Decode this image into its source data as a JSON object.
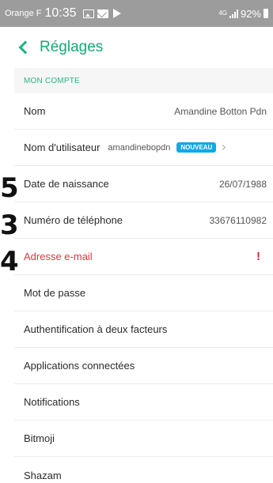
{
  "status_bar": {
    "carrier": "Orange F",
    "time": "10:35",
    "network": "4G",
    "battery": "92%"
  },
  "header": {
    "title": "Réglages"
  },
  "section": {
    "label": "MON COMPTE"
  },
  "rows": {
    "nom": {
      "label": "Nom",
      "value": "Amandine Botton Pdn"
    },
    "username": {
      "label": "Nom d'utilisateur",
      "value": "amandinebopdn",
      "badge": "NOUVEAU"
    },
    "birthdate": {
      "label": "Date de naissance",
      "value": "26/07/1988"
    },
    "phone": {
      "label": "Numéro de téléphone",
      "value": "33676110982"
    },
    "email": {
      "label": "Adresse e-mail",
      "alert": "!"
    },
    "password": {
      "label": "Mot de passe"
    },
    "twofa": {
      "label": "Authentification à deux facteurs"
    },
    "apps": {
      "label": "Applications connectées"
    },
    "notifications": {
      "label": "Notifications"
    },
    "bitmoji": {
      "label": "Bitmoji"
    },
    "shazam": {
      "label": "Shazam"
    }
  },
  "annotations": {
    "a5": "5",
    "a3": "3",
    "a4": "4"
  },
  "colors": {
    "accent": "#17a874",
    "error": "#d0393e",
    "badge": "#11a8e8"
  }
}
